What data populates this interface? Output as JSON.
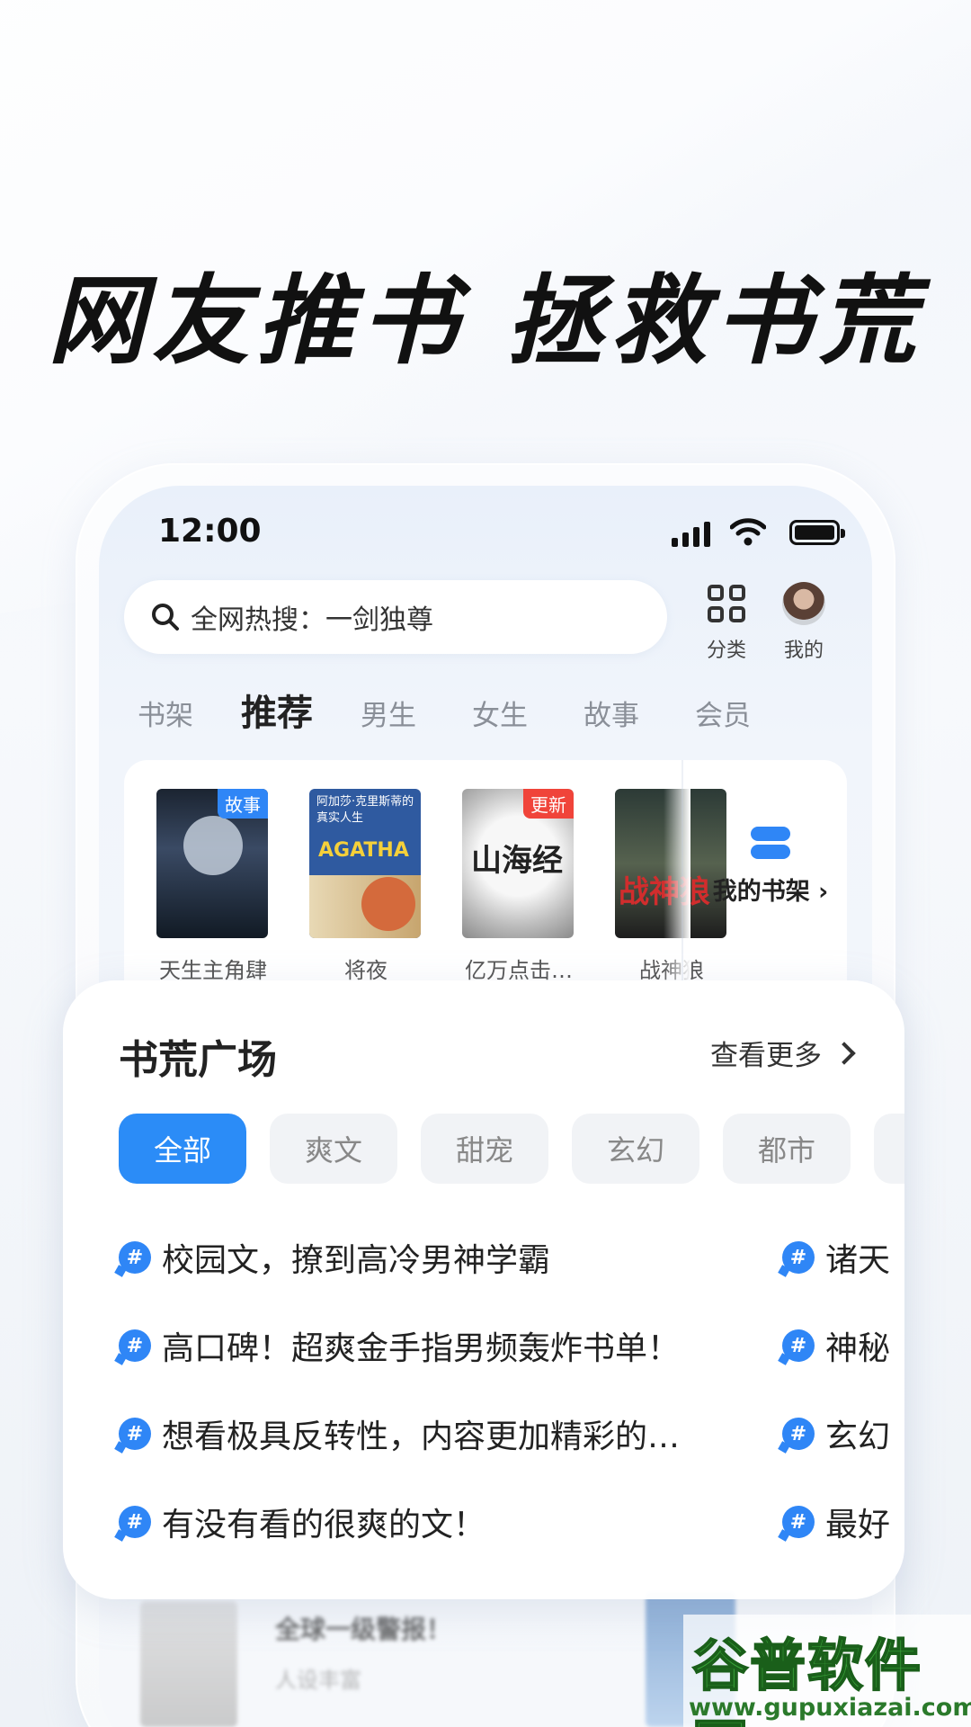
{
  "headline": "网友推书 拯救书荒",
  "status_bar": {
    "time": "12:00"
  },
  "search": {
    "text": "全网热搜：一剑独尊"
  },
  "top_icons": {
    "category_label": "分类",
    "mine_label": "我的"
  },
  "tabs": [
    {
      "label": "书架"
    },
    {
      "label": "推荐",
      "active": true
    },
    {
      "label": "男生"
    },
    {
      "label": "女生"
    },
    {
      "label": "故事"
    },
    {
      "label": "会员"
    }
  ],
  "shelf": {
    "books": [
      {
        "title": "天生主角肆",
        "badge": "故事",
        "badge_color": "#2f86f6"
      },
      {
        "title": "将夜",
        "cover_text": "AGATHA",
        "cover_sub": "阿加莎·克里斯蒂的真实人生"
      },
      {
        "title": "亿万点击…",
        "badge": "更新",
        "badge_color": "#f0443a",
        "cover_text": "山海经"
      },
      {
        "title": "战神狼",
        "cover_text": "战神狼"
      }
    ],
    "my_shelf_label": "我的书架 ›"
  },
  "background_row": {
    "title": "全球一级警报！",
    "subtitle": "人设丰富"
  },
  "plaza": {
    "title": "书荒广场",
    "more_label": "查看更多",
    "chips": [
      {
        "label": "全部",
        "active": true
      },
      {
        "label": "爽文"
      },
      {
        "label": "甜宠"
      },
      {
        "label": "玄幻"
      },
      {
        "label": "都市"
      }
    ],
    "topics_left": [
      "校园文，撩到高冷男神学霸",
      "高口碑！超爽金手指男频轰炸书单！",
      "想看极具反转性，内容更加精彩的…",
      "有没有看的很爽的文！"
    ],
    "topics_right": [
      "诸天",
      "神秘",
      "玄幻",
      "最好"
    ]
  },
  "watermark": {
    "main": "谷普软件园",
    "url": "www.gupuxiazai.com"
  },
  "colors": {
    "accent": "#2b8cf7",
    "badge_red": "#f0443a",
    "watermark_green": "#3aa63a"
  }
}
